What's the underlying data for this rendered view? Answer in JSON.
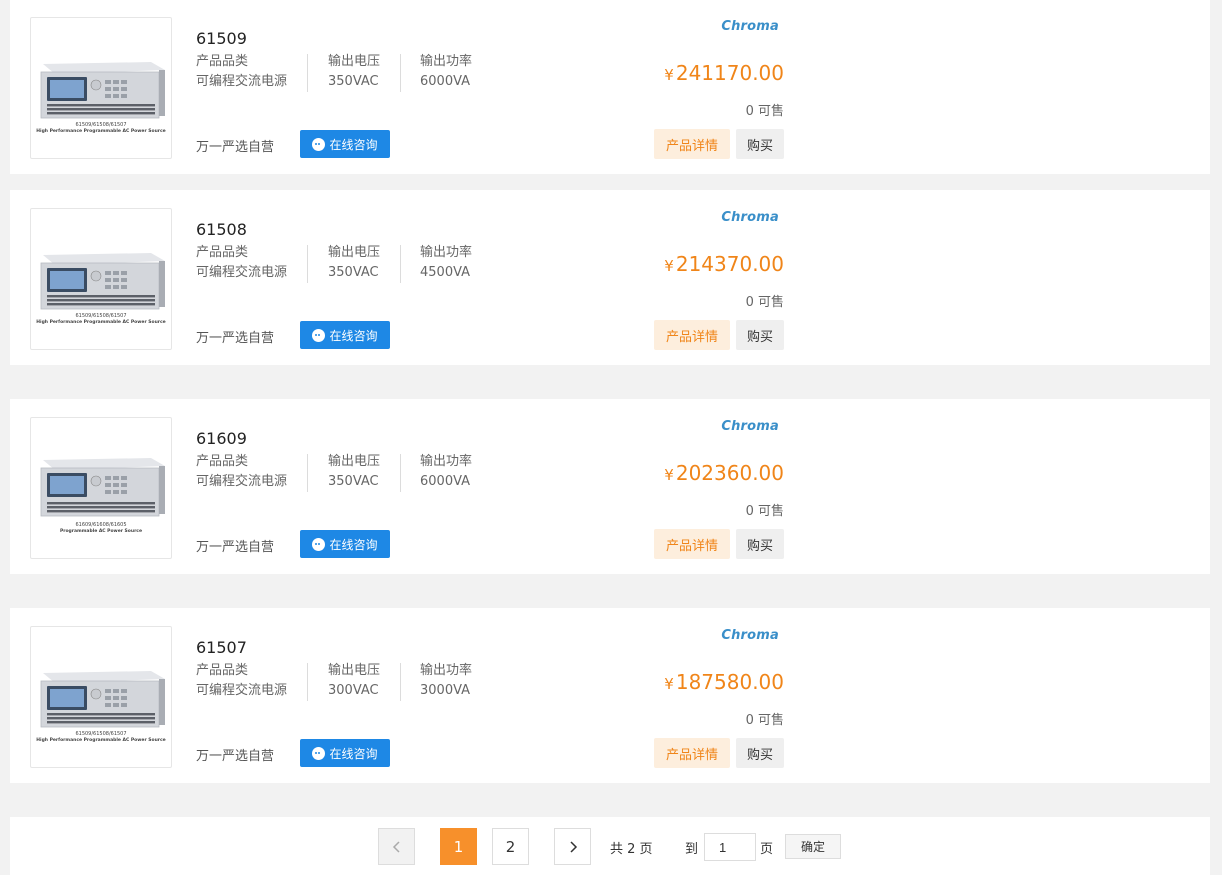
{
  "products": [
    {
      "model": "61509",
      "brand": "Chroma",
      "spec": [
        {
          "label": "产品品类",
          "value": "可编程交流电源"
        },
        {
          "label": "输出电压",
          "value": "350VAC"
        },
        {
          "label": "输出功率",
          "value": "6000VA"
        }
      ],
      "currency": "¥",
      "price": "241170.00",
      "stock": "0 可售",
      "seller": "万一严选自营",
      "consult_label": "在线咨询",
      "detail_label": "产品详情",
      "buy_label": "购买",
      "caption1": "61509/61508/61507",
      "caption2": "High Performance Programmable AC Power Source"
    },
    {
      "model": "61508",
      "brand": "Chroma",
      "spec": [
        {
          "label": "产品品类",
          "value": "可编程交流电源"
        },
        {
          "label": "输出电压",
          "value": "350VAC"
        },
        {
          "label": "输出功率",
          "value": "4500VA"
        }
      ],
      "currency": "¥",
      "price": "214370.00",
      "stock": "0 可售",
      "seller": "万一严选自营",
      "consult_label": "在线咨询",
      "detail_label": "产品详情",
      "buy_label": "购买",
      "caption1": "61509/61508/61507",
      "caption2": "High Performance Programmable AC Power Source"
    },
    {
      "model": "61609",
      "brand": "Chroma",
      "spec": [
        {
          "label": "产品品类",
          "value": "可编程交流电源"
        },
        {
          "label": "输出电压",
          "value": "350VAC"
        },
        {
          "label": "输出功率",
          "value": "6000VA"
        }
      ],
      "currency": "¥",
      "price": "202360.00",
      "stock": "0 可售",
      "seller": "万一严选自营",
      "consult_label": "在线咨询",
      "detail_label": "产品详情",
      "buy_label": "购买",
      "caption1": "61609/61608/61605",
      "caption2": "Programmable AC Power Source"
    },
    {
      "model": "61507",
      "brand": "Chroma",
      "spec": [
        {
          "label": "产品品类",
          "value": "可编程交流电源"
        },
        {
          "label": "输出电压",
          "value": "300VAC"
        },
        {
          "label": "输出功率",
          "value": "3000VA"
        }
      ],
      "currency": "¥",
      "price": "187580.00",
      "stock": "0 可售",
      "seller": "万一严选自营",
      "consult_label": "在线咨询",
      "detail_label": "产品详情",
      "buy_label": "购买",
      "caption1": "61509/61508/61507",
      "caption2": "High Performance Programmable AC Power Source"
    }
  ],
  "pagination": {
    "prev_icon": "chevron-left-icon",
    "pages": [
      "1",
      "2"
    ],
    "current": "1",
    "next_icon": "chevron-right-icon",
    "total_text": "共 2 页",
    "goto_label": "到",
    "goto_value": "1",
    "page_suffix": "页",
    "confirm_label": "确定"
  },
  "colors": {
    "accent_orange": "#f08519",
    "consult_blue": "#1e88e5",
    "brand_blue": "#3a8fc9"
  }
}
